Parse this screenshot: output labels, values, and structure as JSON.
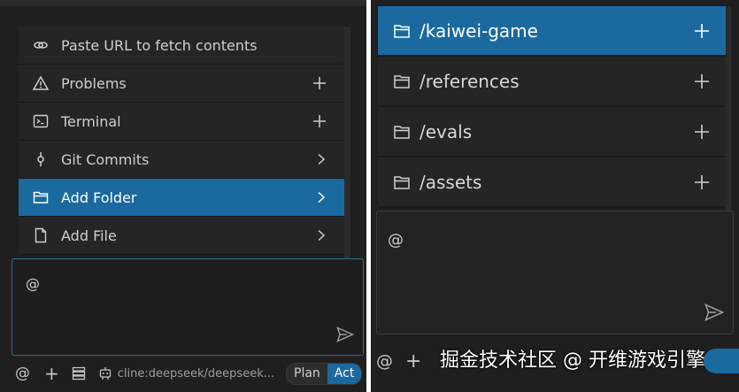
{
  "left": {
    "menu": [
      {
        "icon": "link-icon",
        "label": "Paste URL to fetch contents",
        "trail": ""
      },
      {
        "icon": "warning-icon",
        "label": "Problems",
        "trail": "plus"
      },
      {
        "icon": "terminal-icon",
        "label": "Terminal",
        "trail": "plus"
      },
      {
        "icon": "git-commit-icon",
        "label": "Git Commits",
        "trail": "chevron"
      },
      {
        "icon": "folder-icon",
        "label": "Add Folder",
        "trail": "chevron",
        "selected": true
      },
      {
        "icon": "file-icon",
        "label": "Add File",
        "trail": "chevron"
      }
    ],
    "input_text": "@",
    "toolbar": {
      "at": "@",
      "plus": "+",
      "model": "cline:deepseek/deepseek...",
      "plan": "Plan",
      "act": "Act"
    }
  },
  "right": {
    "folders": [
      {
        "label": "/kaiwei-game",
        "selected": true
      },
      {
        "label": "/references"
      },
      {
        "label": "/evals"
      },
      {
        "label": "/assets"
      }
    ],
    "input_text": "@",
    "toolbar": {
      "at": "@",
      "plus": "+"
    }
  },
  "watermark": "掘金技术社区 @ 开维游戏引擎",
  "colors": {
    "accent": "#1a6aa0",
    "panel": "#252526",
    "background": "#1f1f1f"
  }
}
